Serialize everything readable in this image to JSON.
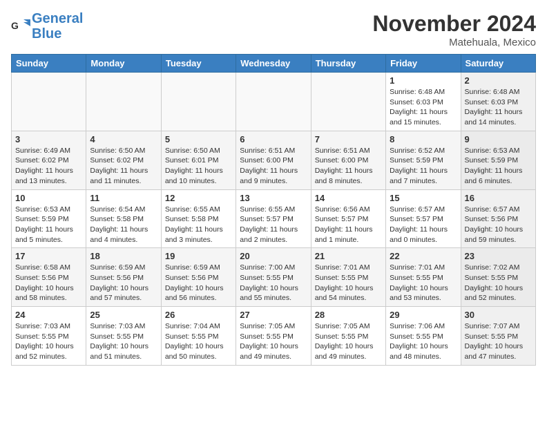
{
  "logo": {
    "line1": "General",
    "line2": "Blue"
  },
  "title": "November 2024",
  "subtitle": "Matehuala, Mexico",
  "days_of_week": [
    "Sunday",
    "Monday",
    "Tuesday",
    "Wednesday",
    "Thursday",
    "Friday",
    "Saturday"
  ],
  "weeks": [
    [
      {
        "day": "",
        "info": ""
      },
      {
        "day": "",
        "info": ""
      },
      {
        "day": "",
        "info": ""
      },
      {
        "day": "",
        "info": ""
      },
      {
        "day": "",
        "info": ""
      },
      {
        "day": "1",
        "info": "Sunrise: 6:48 AM\nSunset: 6:03 PM\nDaylight: 11 hours\nand 15 minutes."
      },
      {
        "day": "2",
        "info": "Sunrise: 6:48 AM\nSunset: 6:03 PM\nDaylight: 11 hours\nand 14 minutes."
      }
    ],
    [
      {
        "day": "3",
        "info": "Sunrise: 6:49 AM\nSunset: 6:02 PM\nDaylight: 11 hours\nand 13 minutes."
      },
      {
        "day": "4",
        "info": "Sunrise: 6:50 AM\nSunset: 6:02 PM\nDaylight: 11 hours\nand 11 minutes."
      },
      {
        "day": "5",
        "info": "Sunrise: 6:50 AM\nSunset: 6:01 PM\nDaylight: 11 hours\nand 10 minutes."
      },
      {
        "day": "6",
        "info": "Sunrise: 6:51 AM\nSunset: 6:00 PM\nDaylight: 11 hours\nand 9 minutes."
      },
      {
        "day": "7",
        "info": "Sunrise: 6:51 AM\nSunset: 6:00 PM\nDaylight: 11 hours\nand 8 minutes."
      },
      {
        "day": "8",
        "info": "Sunrise: 6:52 AM\nSunset: 5:59 PM\nDaylight: 11 hours\nand 7 minutes."
      },
      {
        "day": "9",
        "info": "Sunrise: 6:53 AM\nSunset: 5:59 PM\nDaylight: 11 hours\nand 6 minutes."
      }
    ],
    [
      {
        "day": "10",
        "info": "Sunrise: 6:53 AM\nSunset: 5:59 PM\nDaylight: 11 hours\nand 5 minutes."
      },
      {
        "day": "11",
        "info": "Sunrise: 6:54 AM\nSunset: 5:58 PM\nDaylight: 11 hours\nand 4 minutes."
      },
      {
        "day": "12",
        "info": "Sunrise: 6:55 AM\nSunset: 5:58 PM\nDaylight: 11 hours\nand 3 minutes."
      },
      {
        "day": "13",
        "info": "Sunrise: 6:55 AM\nSunset: 5:57 PM\nDaylight: 11 hours\nand 2 minutes."
      },
      {
        "day": "14",
        "info": "Sunrise: 6:56 AM\nSunset: 5:57 PM\nDaylight: 11 hours\nand 1 minute."
      },
      {
        "day": "15",
        "info": "Sunrise: 6:57 AM\nSunset: 5:57 PM\nDaylight: 11 hours\nand 0 minutes."
      },
      {
        "day": "16",
        "info": "Sunrise: 6:57 AM\nSunset: 5:56 PM\nDaylight: 10 hours\nand 59 minutes."
      }
    ],
    [
      {
        "day": "17",
        "info": "Sunrise: 6:58 AM\nSunset: 5:56 PM\nDaylight: 10 hours\nand 58 minutes."
      },
      {
        "day": "18",
        "info": "Sunrise: 6:59 AM\nSunset: 5:56 PM\nDaylight: 10 hours\nand 57 minutes."
      },
      {
        "day": "19",
        "info": "Sunrise: 6:59 AM\nSunset: 5:56 PM\nDaylight: 10 hours\nand 56 minutes."
      },
      {
        "day": "20",
        "info": "Sunrise: 7:00 AM\nSunset: 5:55 PM\nDaylight: 10 hours\nand 55 minutes."
      },
      {
        "day": "21",
        "info": "Sunrise: 7:01 AM\nSunset: 5:55 PM\nDaylight: 10 hours\nand 54 minutes."
      },
      {
        "day": "22",
        "info": "Sunrise: 7:01 AM\nSunset: 5:55 PM\nDaylight: 10 hours\nand 53 minutes."
      },
      {
        "day": "23",
        "info": "Sunrise: 7:02 AM\nSunset: 5:55 PM\nDaylight: 10 hours\nand 52 minutes."
      }
    ],
    [
      {
        "day": "24",
        "info": "Sunrise: 7:03 AM\nSunset: 5:55 PM\nDaylight: 10 hours\nand 52 minutes."
      },
      {
        "day": "25",
        "info": "Sunrise: 7:03 AM\nSunset: 5:55 PM\nDaylight: 10 hours\nand 51 minutes."
      },
      {
        "day": "26",
        "info": "Sunrise: 7:04 AM\nSunset: 5:55 PM\nDaylight: 10 hours\nand 50 minutes."
      },
      {
        "day": "27",
        "info": "Sunrise: 7:05 AM\nSunset: 5:55 PM\nDaylight: 10 hours\nand 49 minutes."
      },
      {
        "day": "28",
        "info": "Sunrise: 7:05 AM\nSunset: 5:55 PM\nDaylight: 10 hours\nand 49 minutes."
      },
      {
        "day": "29",
        "info": "Sunrise: 7:06 AM\nSunset: 5:55 PM\nDaylight: 10 hours\nand 48 minutes."
      },
      {
        "day": "30",
        "info": "Sunrise: 7:07 AM\nSunset: 5:55 PM\nDaylight: 10 hours\nand 47 minutes."
      }
    ]
  ]
}
